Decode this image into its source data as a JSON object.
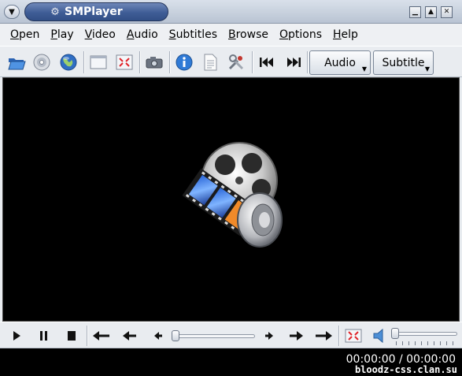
{
  "window": {
    "title": "SMPlayer"
  },
  "menu": [
    {
      "label": "Open",
      "ul": "O",
      "rest": "pen"
    },
    {
      "label": "Play",
      "ul": "P",
      "rest": "lay"
    },
    {
      "label": "Video",
      "ul": "V",
      "rest": "ideo"
    },
    {
      "label": "Audio",
      "ul": "A",
      "rest": "udio"
    },
    {
      "label": "Subtitles",
      "ul": "S",
      "rest": "ubtitles"
    },
    {
      "label": "Browse",
      "ul": "B",
      "rest": "rowse"
    },
    {
      "label": "Options",
      "ul": "O",
      "rest": "ptions"
    },
    {
      "label": "Help",
      "ul": "H",
      "rest": "elp"
    }
  ],
  "toolbar": {
    "audio_label": "Audio",
    "subtitle_label": "Subtitle"
  },
  "status": {
    "time": "00:00:00 / 00:00:00",
    "watermark": "bloodz-css.clan.su"
  },
  "colors": {
    "titlebar_pill": "#3f5d96",
    "video_bg": "#000000"
  }
}
